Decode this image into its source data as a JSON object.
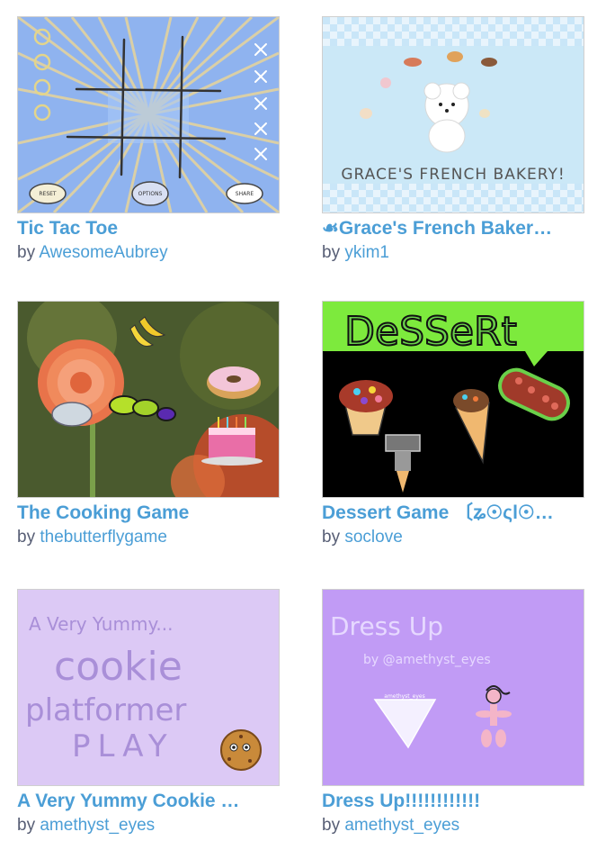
{
  "projects": [
    {
      "title": "Tic Tac Toe",
      "by": "by",
      "author": "AwesomeAubrey",
      "thumb": {
        "buttons": [
          "RESET",
          "OPTIONS",
          "SHARE"
        ]
      }
    },
    {
      "title": "☙Grace's French Baker…",
      "by": "by",
      "author": "ykim1",
      "thumb": {
        "text": "GRACE'S FRENCH BAKERY!"
      }
    },
    {
      "title": "The Cooking Game",
      "by": "by",
      "author": "thebutterflygame",
      "thumb": {}
    },
    {
      "title": "Dessert Game 〔ʑ☉ςl☉…",
      "by": "by",
      "author": "soclove",
      "thumb": {
        "text": "DeSSeRt"
      }
    },
    {
      "title": "A Very Yummy Cookie …",
      "by": "by",
      "author": "amethyst_eyes",
      "thumb": {
        "line1": "A Very Yummy...",
        "line2": "cookie",
        "line3": "platformer",
        "line4": "PLAY"
      }
    },
    {
      "title": "Dress Up!!!!!!!!!!!!",
      "by": "by",
      "author": "amethyst_eyes",
      "thumb": {
        "line1": "Dress Up",
        "line2": "by @amethyst_eyes",
        "label": "amethyst_eyes"
      }
    }
  ],
  "colors": {
    "title": "#4b9ed6",
    "byline": "#575e75"
  }
}
